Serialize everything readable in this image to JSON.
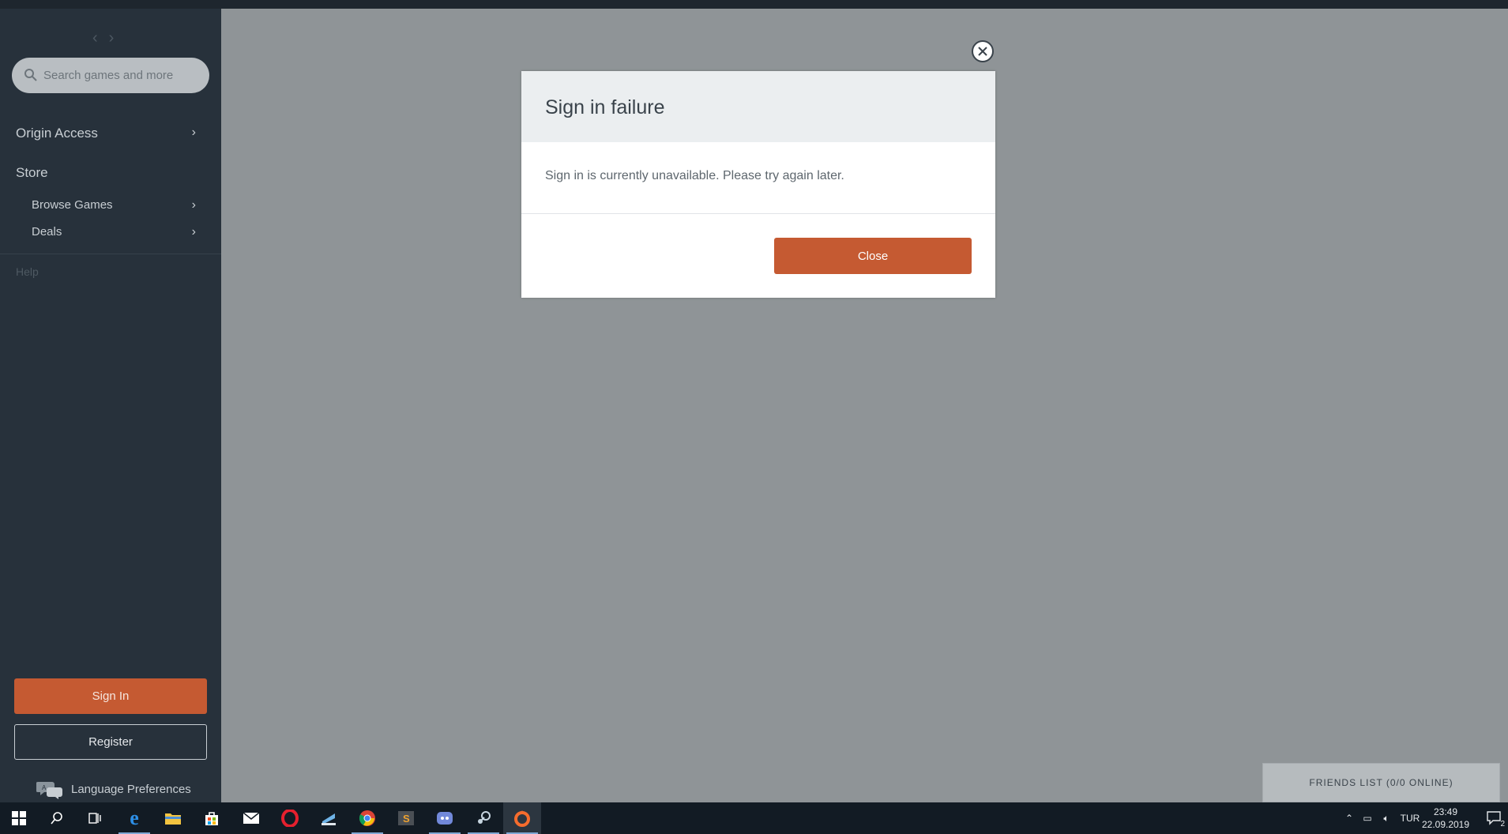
{
  "sidebar": {
    "search_placeholder": "Search games and more",
    "origin_access": "Origin Access",
    "store": "Store",
    "browse_games": "Browse Games",
    "deals": "Deals",
    "help": "Help",
    "sign_in": "Sign In",
    "register": "Register",
    "language_preferences": "Language Preferences"
  },
  "modal": {
    "title": "Sign in failure",
    "message": "Sign in is currently unavailable. Please try again later.",
    "close_button": "Close"
  },
  "friends_list": "FRIENDS LIST (0/0 ONLINE)",
  "taskbar": {
    "language": "TUR",
    "time": "23:49",
    "date": "22.09.2019",
    "notification_count": "2"
  },
  "colors": {
    "accent": "#c55a32",
    "sidebar_bg": "#27313b",
    "main_bg": "#8f9497"
  }
}
